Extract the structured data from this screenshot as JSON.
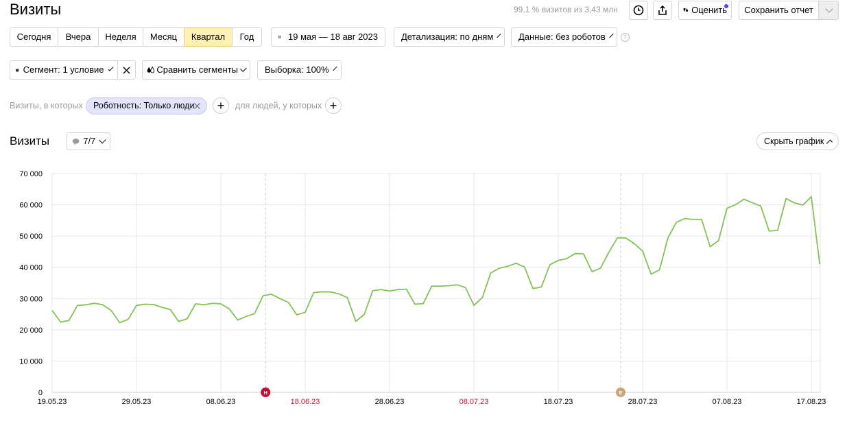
{
  "header": {
    "title": "Визиты",
    "sampling_info": "99,1 % визитов из 3,43 млн",
    "rate_label": "Оценить",
    "save_report_label": "Сохранить отчет"
  },
  "period_tabs": [
    {
      "label": "Сегодня",
      "active": false
    },
    {
      "label": "Вчера",
      "active": false
    },
    {
      "label": "Неделя",
      "active": false
    },
    {
      "label": "Месяц",
      "active": false
    },
    {
      "label": "Квартал",
      "active": true
    },
    {
      "label": "Год",
      "active": false
    }
  ],
  "date_range": "19 мая — 18 авг 2023",
  "detail_select": "Детализация: по дням",
  "data_select": "Данные: без роботов",
  "segment_button": "Сегмент: 1 условие",
  "compare_segments": "Сравнить сегменты",
  "sample_select": "Выборка: 100%",
  "filters": {
    "visits_prefix": "Визиты, в которых",
    "tag_label": "Роботность: Только люди",
    "people_prefix": "для людей, у которых"
  },
  "chart_section": {
    "title": "Визиты",
    "annotations_count": "7/7",
    "hide_chart_label": "Скрыть график"
  },
  "colors": {
    "line": "#82c255",
    "active_tab": "#fff1b3",
    "holiday_label": "#c8102e",
    "marker_red": "#c8102e",
    "marker_tan": "#c9a57a",
    "tag_bg": "#e3e4fb"
  },
  "markers": [
    {
      "letter": "Н",
      "date": "13.06.23",
      "color": "#c8102e"
    },
    {
      "letter": "Е",
      "date": "24.07.23",
      "color": "#c9a57a"
    }
  ],
  "chart_data": {
    "type": "line",
    "title": "",
    "xlabel": "",
    "ylabel": "",
    "ylim": [
      0,
      70000
    ],
    "yticks": [
      "0",
      "10 000",
      "20 000",
      "30 000",
      "40 000",
      "50 000",
      "60 000",
      "70 000"
    ],
    "xtick_labels": [
      {
        "label": "19.05.23",
        "index": 0,
        "holiday": false
      },
      {
        "label": "29.05.23",
        "index": 10,
        "holiday": false
      },
      {
        "label": "08.06.23",
        "index": 20,
        "holiday": false
      },
      {
        "label": "18.06.23",
        "index": 30,
        "holiday": true
      },
      {
        "label": "28.06.23",
        "index": 40,
        "holiday": false
      },
      {
        "label": "08.07.23",
        "index": 50,
        "holiday": true
      },
      {
        "label": "18.07.23",
        "index": 60,
        "holiday": false
      },
      {
        "label": "28.07.23",
        "index": 70,
        "holiday": false
      },
      {
        "label": "07.08.23",
        "index": 80,
        "holiday": false
      },
      {
        "label": "17.08.23",
        "index": 90,
        "holiday": false
      }
    ],
    "grid": true,
    "series": [
      {
        "values": [
          26200,
          22500,
          23000,
          27800,
          28000,
          28500,
          28000,
          26200,
          22300,
          23300,
          27800,
          28200,
          28100,
          27200,
          26500,
          22700,
          23500,
          28300,
          28000,
          28500,
          28300,
          26700,
          23100,
          24300,
          25200,
          30900,
          31400,
          30000,
          28800,
          24800,
          25600,
          31900,
          32200,
          32100,
          31500,
          30300,
          22700,
          24900,
          32500,
          32900,
          32400,
          32900,
          33000,
          28200,
          28400,
          34000,
          34000,
          34100,
          34400,
          33500,
          27800,
          30300,
          38200,
          39700,
          40300,
          41300,
          40100,
          33200,
          33700,
          40800,
          42200,
          42800,
          44400,
          44300,
          38600,
          39700,
          44800,
          49400,
          49400,
          47600,
          45200,
          37800,
          39200,
          49400,
          54400,
          55600,
          55300,
          55300,
          46600,
          48500,
          58900,
          60000,
          61800,
          60700,
          59600,
          51600,
          51800,
          62000,
          60600,
          59900,
          62600,
          41000
        ]
      }
    ]
  }
}
